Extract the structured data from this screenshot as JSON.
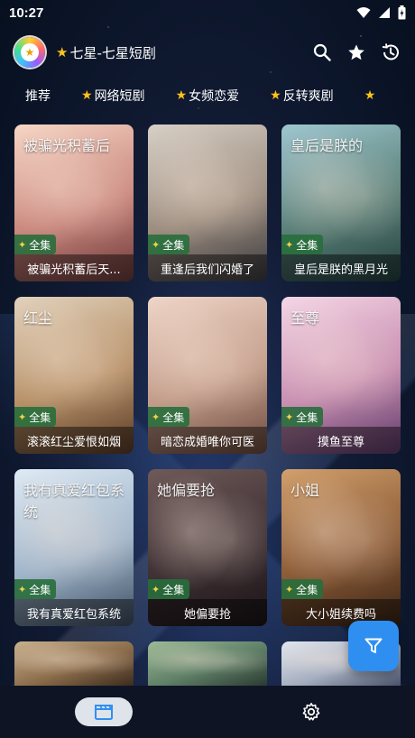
{
  "status": {
    "time": "10:27"
  },
  "app": {
    "title": "七星-七星短剧"
  },
  "tabs": [
    {
      "label": "推荐",
      "starred": false
    },
    {
      "label": "网络短剧",
      "starred": true
    },
    {
      "label": "女频恋爱",
      "starred": true
    },
    {
      "label": "反转爽剧",
      "starred": true
    },
    {
      "label": "",
      "starred": true
    }
  ],
  "cards": [
    {
      "title": "被骗光积蓄后天...",
      "badge": "全集",
      "poster_text": "被骗光积蓄后",
      "colors": [
        "#f6d7c7",
        "#c9867c",
        "#6d3a3b"
      ]
    },
    {
      "title": "重逢后我们闪婚了",
      "badge": "全集",
      "poster_text": "",
      "colors": [
        "#d8d0c7",
        "#9a8b7d",
        "#3b3a3f"
      ]
    },
    {
      "title": "皇后是朕的黑月光",
      "badge": "全集",
      "poster_text": "皇后是朕的",
      "colors": [
        "#9fc7d0",
        "#5a7f77",
        "#233f3e"
      ]
    },
    {
      "title": "滚滚红尘爱恨如烟",
      "badge": "全集",
      "poster_text": "红尘",
      "colors": [
        "#e2d2bd",
        "#b58f66",
        "#5a3b27"
      ]
    },
    {
      "title": "暗恋成婚唯你可医",
      "badge": "全集",
      "poster_text": "",
      "colors": [
        "#efd6c8",
        "#c19a88",
        "#6a4a3e"
      ]
    },
    {
      "title": "摸鱼至尊",
      "badge": "全集",
      "poster_text": "至尊",
      "colors": [
        "#f5d7e6",
        "#c78db0",
        "#5d3a69"
      ]
    },
    {
      "title": "我有真爱红包系统",
      "badge": "全集",
      "poster_text": "我有真爱红包系统",
      "colors": [
        "#dfeaf4",
        "#9db3c9",
        "#3c4c5f"
      ]
    },
    {
      "title": "她偏要抢",
      "badge": "全集",
      "poster_text": "她偏要抢",
      "colors": [
        "#6f5a59",
        "#3e3033",
        "#1b1417"
      ]
    },
    {
      "title": "大小姐续费吗",
      "badge": "全集",
      "poster_text": "小姐",
      "colors": [
        "#d2a06d",
        "#8a5a35",
        "#3a2416"
      ]
    },
    {
      "title": "",
      "badge": "",
      "poster_text": "",
      "colors": [
        "#c9b18e",
        "#8c6d4b",
        "#3c2b1d"
      ]
    },
    {
      "title": "",
      "badge": "",
      "poster_text": "",
      "colors": [
        "#9dbb96",
        "#5f7f67",
        "#2b3b31"
      ]
    },
    {
      "title": "",
      "badge": "",
      "poster_text": "",
      "colors": [
        "#e2e6ee",
        "#a6afc0",
        "#49526a"
      ]
    }
  ],
  "icons": {
    "search": "search-icon",
    "favorite": "star-icon",
    "history": "history-icon",
    "filter": "filter-icon",
    "video": "clapperboard-icon",
    "settings": "gear-icon"
  },
  "colors": {
    "accent": "#2f8ff0",
    "star": "#ffc21a",
    "badge": "#2e6e3c"
  }
}
